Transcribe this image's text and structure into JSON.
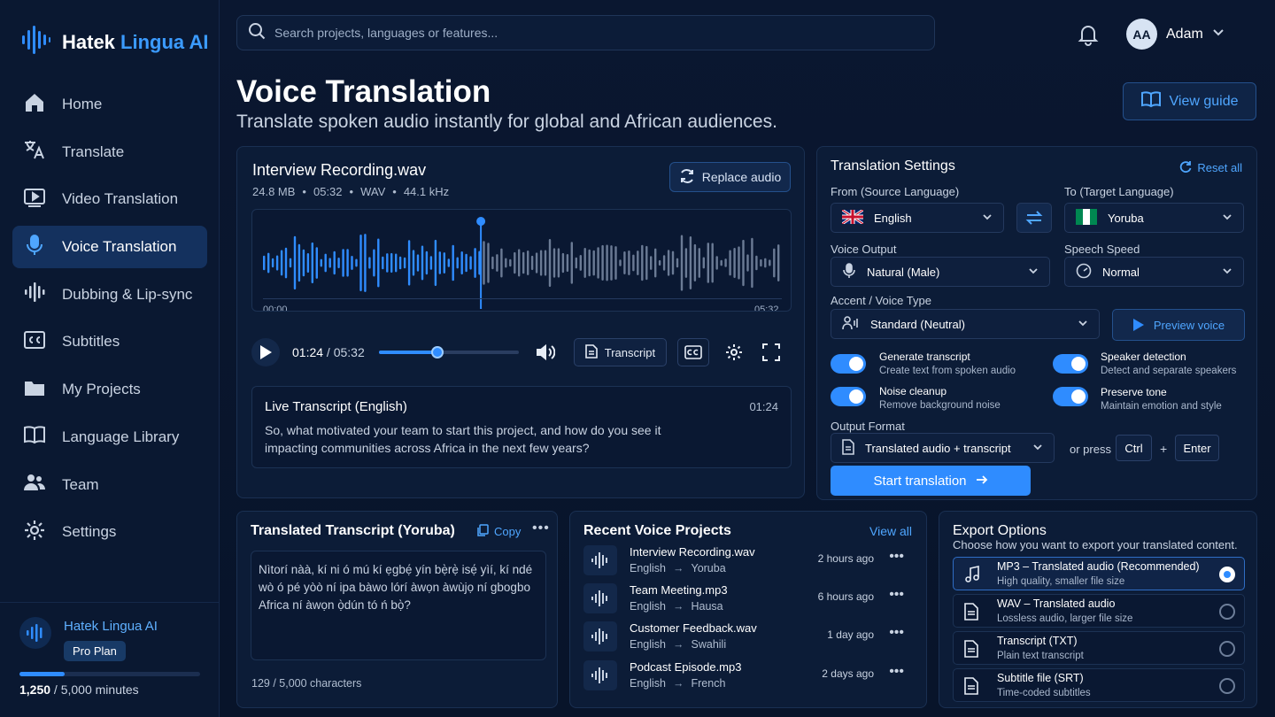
{
  "brand": {
    "name_a": "Hatek ",
    "name_b": "Lingua AI"
  },
  "nav": [
    {
      "label": "Home",
      "icon": "home-icon"
    },
    {
      "label": "Translate",
      "icon": "translate-icon"
    },
    {
      "label": "Video Translation",
      "icon": "video-icon"
    },
    {
      "label": "Voice Translation",
      "icon": "microphone-icon",
      "active": true
    },
    {
      "label": "Dubbing & Lip-sync",
      "icon": "waveform-icon"
    },
    {
      "label": "Subtitles",
      "icon": "cc-icon"
    },
    {
      "label": "My Projects",
      "icon": "folder-icon"
    },
    {
      "label": "Language Library",
      "icon": "book-icon"
    },
    {
      "label": "Team",
      "icon": "team-icon"
    },
    {
      "label": "Settings",
      "icon": "gear-icon"
    }
  ],
  "plan": {
    "name": "Hatek Lingua AI",
    "badge": "Pro Plan",
    "used": "1,250",
    "total": " / 5,000 minutes",
    "usage_fraction": 0.25
  },
  "search": {
    "placeholder": "Search projects, languages or features..."
  },
  "user": {
    "initials": "AA",
    "name": "Adam"
  },
  "page": {
    "title": "Voice Translation",
    "subtitle": "Translate spoken audio instantly for global and African audiences.",
    "guide": "View guide"
  },
  "audio": {
    "file_name": "Interview Recording.wav",
    "meta": [
      "24.8 MB",
      "•",
      "05:32",
      "•",
      "WAV",
      "•",
      "44.1 kHz"
    ],
    "replace": "Replace audio",
    "wave_start": "00:00",
    "wave_end": "05:32",
    "current": "01:24",
    "total": " / 05:32",
    "progress": 0.42,
    "transcript_btn": "Transcript"
  },
  "live": {
    "title": "Live Transcript (English)",
    "time": "01:24",
    "text": "So, what motivated your team to start this project, and how do you see it impacting communities across Africa in the next few years?"
  },
  "settings": {
    "title": "Translation Settings",
    "reset": "Reset all",
    "from_label": "From (Source Language)",
    "from_value": "English",
    "to_label": "To (Target Language)",
    "to_value": "Yoruba",
    "voice_label": "Voice Output",
    "voice_value": "Natural (Male)",
    "speed_label": "Speech Speed",
    "speed_value": "Normal",
    "accent_label": "Accent / Voice Type",
    "accent_value": "Standard (Neutral)",
    "preview": "Preview voice",
    "toggles": [
      {
        "name": "Generate transcript",
        "desc": "Create text from spoken audio",
        "on": true
      },
      {
        "name": "Speaker detection",
        "desc": "Detect and separate speakers",
        "on": true
      },
      {
        "name": "Noise cleanup",
        "desc": "Remove background noise",
        "on": true
      },
      {
        "name": "Preserve tone",
        "desc": "Maintain emotion and style",
        "on": true
      }
    ],
    "format_label": "Output Format",
    "format_value": "Translated audio + transcript",
    "or_press": "or press",
    "key1": "Ctrl",
    "plus": "+",
    "key2": "Enter",
    "start": "Start translation"
  },
  "translated": {
    "title": "Translated Transcript (Yoruba)",
    "copy": "Copy",
    "text": "Nìtorí nàà, kí ni ó mú kí ẹgbẹ́ yín bẹ̀rẹ̀ isẹ́ yìí, kí ndé wò ó pé yòò ní ipa bàwo lórí àwọn àwùjọ ní gbogbo Africa ní àwọn ọ̀dún tó ń bọ̀?",
    "count": "129 / 5,000 characters"
  },
  "recent": {
    "title": "Recent Voice Projects",
    "view_all": "View all",
    "items": [
      {
        "name": "Interview Recording.wav",
        "from": "English",
        "to": "Yoruba",
        "time": "2 hours ago"
      },
      {
        "name": "Team Meeting.mp3",
        "from": "English",
        "to": "Hausa",
        "time": "6 hours ago"
      },
      {
        "name": "Customer Feedback.wav",
        "from": "English",
        "to": "Swahili",
        "time": "1 day ago"
      },
      {
        "name": "Podcast Episode.mp3",
        "from": "English",
        "to": "French",
        "time": "2 days ago"
      }
    ]
  },
  "export": {
    "title": "Export Options",
    "subtitle": "Choose how you want to export your translated content.",
    "options": [
      {
        "name": "MP3 – Translated audio (Recommended)",
        "desc": "High quality, smaller file size",
        "selected": true
      },
      {
        "name": "WAV – Translated audio",
        "desc": "Lossless audio, larger file size",
        "selected": false
      },
      {
        "name": "Transcript (TXT)",
        "desc": "Plain text transcript",
        "selected": false
      },
      {
        "name": "Subtitle file (SRT)",
        "desc": "Time-coded subtitles",
        "selected": false
      }
    ]
  },
  "colors": {
    "accent": "#2f8cff",
    "link": "#4fa6ff",
    "bg": "#081428",
    "card": "#0c1c37"
  }
}
